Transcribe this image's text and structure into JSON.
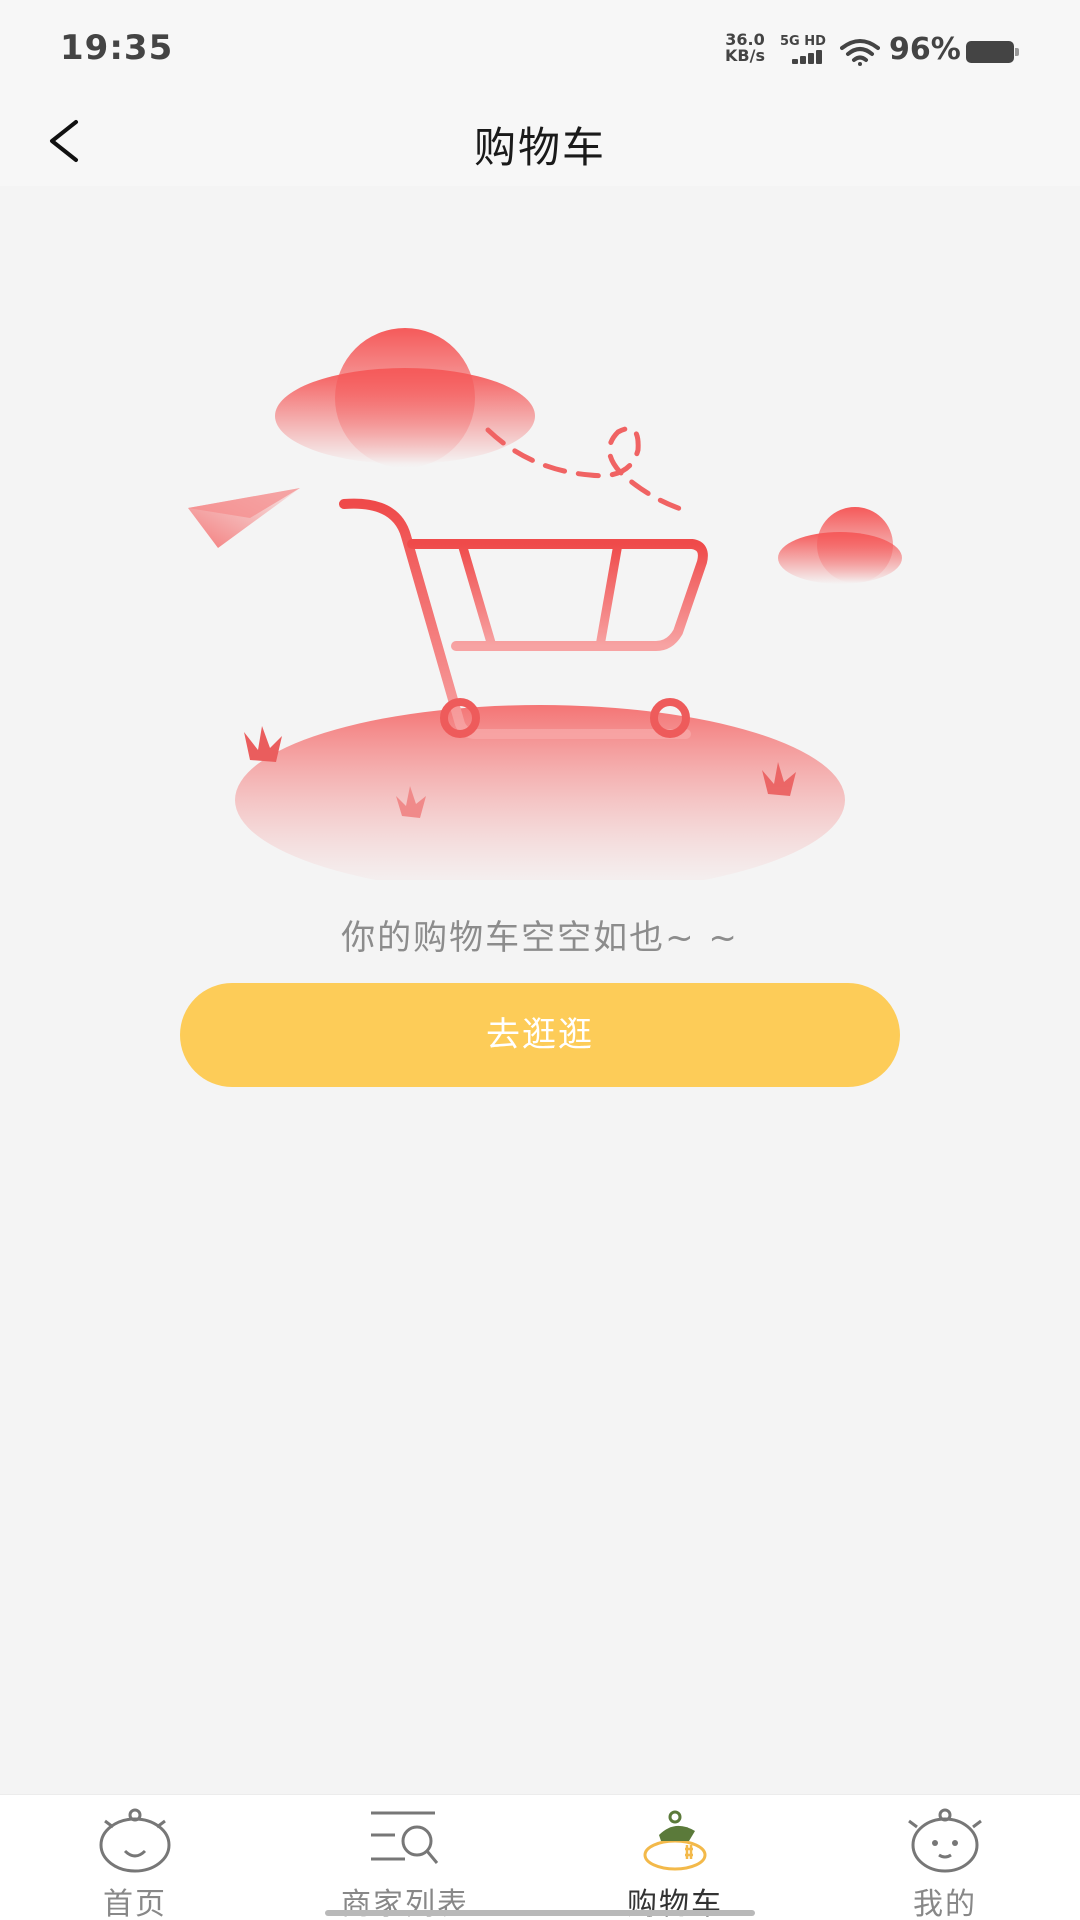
{
  "status_bar": {
    "time": "19:35",
    "net_speed_value": "36.0",
    "net_speed_unit": "KB/s",
    "net_type": "5G HD",
    "battery_percent": "96%"
  },
  "nav": {
    "back_icon": "chevron-left-icon",
    "title": "购物车"
  },
  "empty_state": {
    "illustration": "empty-shopping-cart-illustration",
    "message": "你的购物车空空如也~ ~",
    "button_label": "去逛逛"
  },
  "colors": {
    "accent_yellow": "#fdcc58",
    "illustration_red": "#f25757",
    "background": "#f4f4f4"
  },
  "tabs": [
    {
      "label": "首页",
      "icon": "home-icon",
      "active": false
    },
    {
      "label": "商家列表",
      "icon": "merchant-list-icon",
      "active": false
    },
    {
      "label": "购物车",
      "icon": "cart-tab-icon",
      "active": true
    },
    {
      "label": "我的",
      "icon": "profile-icon",
      "active": false
    }
  ]
}
